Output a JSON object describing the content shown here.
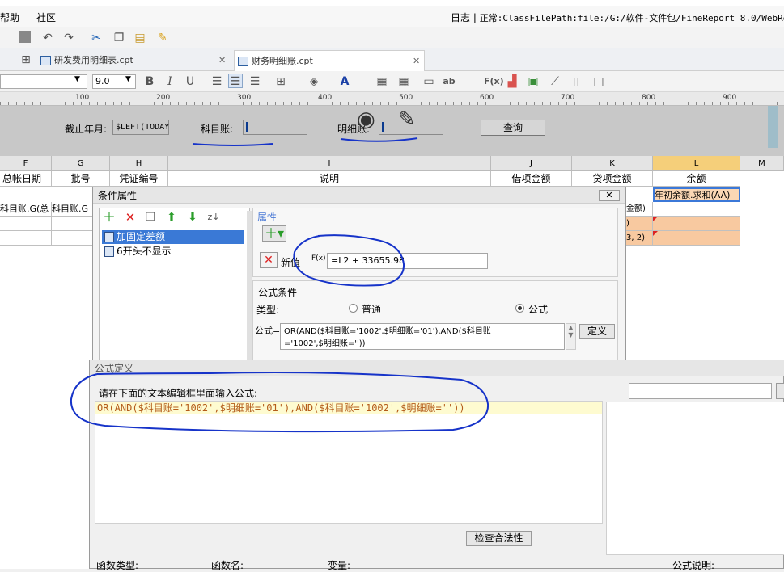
{
  "app": {
    "menu": [
      "帮助",
      "社区"
    ],
    "log_label": "日志",
    "status_text": "正常:ClassFilePath:file:/G:/软件-文件包/FineReport_8.0/WebRepor"
  },
  "tabs": [
    {
      "label": "研发费用明细表.cpt",
      "active": false
    },
    {
      "label": "财务明细账.cpt",
      "active": true
    }
  ],
  "toolbar2": {
    "font_size": "9.0"
  },
  "ruler": {
    "labels": [
      "100",
      "200",
      "300",
      "400",
      "500",
      "600",
      "700",
      "800",
      "900"
    ]
  },
  "params": {
    "cutoff_label": "截止年月:",
    "cutoff_value": "$LEFT(TODAY",
    "subject_label": "科目账:",
    "detail_label": "明细账:",
    "query_button": "查询"
  },
  "grid": {
    "columns": [
      "F",
      "G",
      "H",
      "I",
      "J",
      "K",
      "L",
      "M"
    ],
    "header_row": [
      "总帐日期",
      "批号",
      "凭证编号",
      "说明",
      "借项金额",
      "贷项金额",
      "余额"
    ],
    "row1": {
      "f": "科目账.G(总",
      "g": "科目账.G",
      "k": "金额)",
      "l": "年初余额.求和(AA)"
    },
    "row2": {
      "k": ")"
    },
    "row3": {
      "k": "3, 2)"
    }
  },
  "condition_dialog": {
    "title": "条件属性",
    "items": [
      "加固定差额",
      "6开头不显示"
    ],
    "attr_title": "属性",
    "new_value_label": "新值",
    "fx_label": "F(x)",
    "new_value": "=L2 + 33655.98",
    "formula_cond_title": "公式条件",
    "type_label": "类型:",
    "type_normal": "普通",
    "type_formula": "公式",
    "formula_label": "公式=",
    "formula_text": "OR(AND($科目账='1002',$明细账='01'),AND($科目账\n='1002',$明细账=''))",
    "define_button": "定义"
  },
  "formula_dialog": {
    "title": "公式定义",
    "prompt": "请在下面的文本编辑框里面输入公式:",
    "formula": "OR(AND($科目账='1002',$明细账='01'),AND($科目账='1002',$明细账=''))",
    "check_button": "检查合法性",
    "func_type_label": "函数类型:",
    "func_name_label": "函数名:",
    "var_label": "变量:",
    "formula_desc_label": "公式说明:"
  }
}
